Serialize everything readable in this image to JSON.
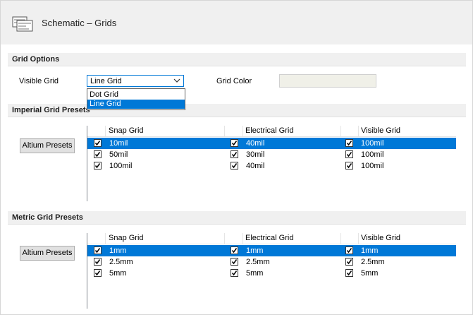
{
  "header": {
    "title": "Schematic – Grids",
    "icon": "schematic-page-icon"
  },
  "grid_options": {
    "section_title": "Grid Options",
    "visible_grid_label": "Visible Grid",
    "visible_grid_value": "Line Grid",
    "visible_grid_options": [
      "Dot Grid",
      "Line Grid"
    ],
    "selected_option_index": 1,
    "grid_color_label": "Grid Color",
    "grid_color_value": "#f0f0e8"
  },
  "imperial": {
    "section_title": "Imperial Grid Presets",
    "preset_button": "Altium Presets",
    "columns": [
      "Snap Grid",
      "Electrical Grid",
      "Visible Grid"
    ],
    "rows": [
      {
        "snap": "10mil",
        "electrical": "40mil",
        "visible": "100mil",
        "selected": true
      },
      {
        "snap": "50mil",
        "electrical": "30mil",
        "visible": "100mil",
        "selected": false
      },
      {
        "snap": "100mil",
        "electrical": "40mil",
        "visible": "100mil",
        "selected": false
      }
    ]
  },
  "metric": {
    "section_title": "Metric Grid Presets",
    "preset_button": "Altium Presets",
    "columns": [
      "Snap Grid",
      "Electrical Grid",
      "Visible Grid"
    ],
    "rows": [
      {
        "snap": "1mm",
        "electrical": "1mm",
        "visible": "1mm",
        "selected": true
      },
      {
        "snap": "2.5mm",
        "electrical": "2.5mm",
        "visible": "2.5mm",
        "selected": false
      },
      {
        "snap": "5mm",
        "electrical": "5mm",
        "visible": "5mm",
        "selected": false
      }
    ]
  },
  "colors": {
    "selection": "#0078d7",
    "section_bg": "#f0f0f0"
  }
}
